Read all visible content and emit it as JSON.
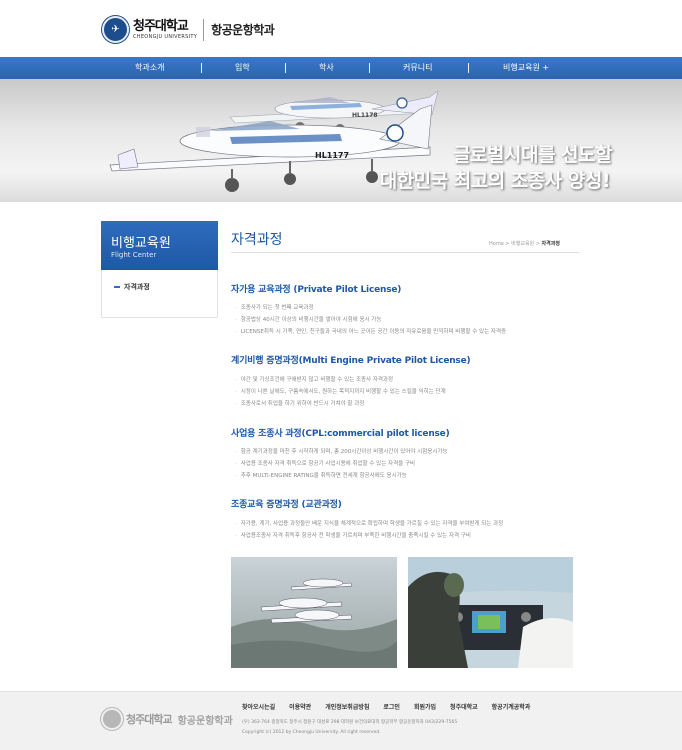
{
  "header": {
    "university_name": "청주대학교",
    "university_name_en": "CHEONGJU UNIVERSITY",
    "department": "항공운항학과"
  },
  "nav": {
    "items": [
      "학과소개",
      "입학",
      "학사",
      "커뮤니티",
      "비행교육원 +"
    ]
  },
  "banner": {
    "aircraft_tail_1": "HL1178",
    "aircraft_tail_2": "HL1177",
    "slogan_line1": "글로벌시대를 선도할",
    "slogan_line2": "대한민국 최고의 조종사 양성!"
  },
  "sidebar": {
    "title": "비행교육원",
    "subtitle": "Flight Center",
    "items": [
      {
        "label": "자격과정"
      }
    ]
  },
  "main": {
    "title": "자격과정",
    "breadcrumb": {
      "home": "Home",
      "sep1": " > ",
      "parent": "비행교육원",
      "sep2": " > ",
      "current": "자격과정"
    },
    "sections": [
      {
        "title": "자가용 교육과정 (Private Pilot License)",
        "bullets": [
          "조종사가 되는 첫 번째 교육과정",
          "항공법상 40시간 이상의 비행시간을 쌓아야 시험에 응시 가능",
          "LICENSE취득 시 가족, 연인, 친구들과 국내의 어느 곳이든 공간 이동의 자유로움을 만끽하며 비행할 수 있는 자격증"
        ]
      },
      {
        "title": "계기비행 증명과정(Multi Engine Private Pilot License)",
        "bullets": [
          "야간 및 기상조건에 구애받지 않고 비행할 수 있는 조종사 자격과정",
          "시정이 나쁜 날에도, 구름속에서도, 원하는 목적지까지 비행할 수 있는 스킬을 익히는 단계",
          "조종사로서 취업을 하기 위하여 반드시 거쳐야 할 과정"
        ]
      },
      {
        "title": "사업용 조종사 과정(CPL:commercial pilot license)",
        "bullets": [
          "항공 계기과정을 마친 후 시작하게 되며, 총 200시간이상 비행시간이 있어야 시험응시가능",
          "사업용 조종사 자격 취득으로 항공기 사업시용에 취업할 수 있는 자격을 구비",
          "추후 MULTI-ENGINE RATING을 취득하면 전세계 항공사에도 응시가능"
        ]
      },
      {
        "title": "조종교육 증명과정 (교관과정)",
        "bullets": [
          "자가용, 계기, 사업용 과정들안 배운 지식을 체계적으로 확립하며 학생을 가르칠 수 있는 자격을 부여받게 되는 과정",
          "사업용조종사 자격 취득후 항공사 전 학생을 가르치며 부족한 비행시간을 충족시킬 수 있는 자격 구비"
        ]
      }
    ]
  },
  "footer": {
    "university_name": "청주대학교",
    "department": "항공운항학과",
    "links": [
      "찾아오시는길",
      "이용약관",
      "개인정보취급방침",
      "로그인",
      "회원가입",
      "청주대학교",
      "항공기계공학과"
    ],
    "address": "(우) 363-764 충청북도 청주시 청원구 대성로 298 대학원 보건의료대학 항공학부 항공운항학과 043)229-7565",
    "copyright": "Copyright (c) 2012 by Cheongju University. All right reserved."
  },
  "colors": {
    "brand_blue": "#2c63ad",
    "title_blue": "#1e58a6",
    "footer_bg": "#f1f1f1"
  }
}
